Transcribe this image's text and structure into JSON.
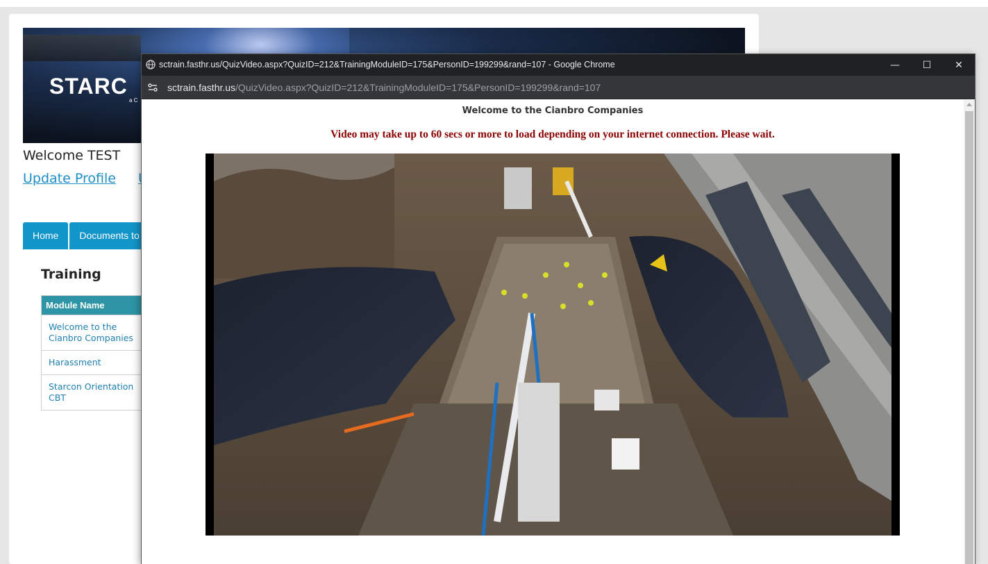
{
  "page": {
    "banner": {
      "logo_text": "STARC",
      "logo_sub": "a C"
    },
    "welcome": "Welcome TEST",
    "links": [
      "Update Profile",
      "U"
    ],
    "tabs": [
      "Home",
      "Documents to C"
    ],
    "training_title": "Training",
    "module_table": {
      "header": "Module Name",
      "rows": [
        "Welcome to the Cianbro Companies",
        "Harassment",
        "Starcon Orientation CBT"
      ]
    }
  },
  "popup": {
    "window_title": "sctrain.fasthr.us/QuizVideo.aspx?QuizID=212&TrainingModuleID=175&PersonID=199299&rand=107 - Google Chrome",
    "address_host": "sctrain.fasthr.us",
    "address_path": "/QuizVideo.aspx?QuizID=212&TrainingModuleID=175&PersonID=199299&rand=107",
    "controls": {
      "minimize": "—",
      "maximize": "☐",
      "close": "✕"
    },
    "heading": "Welcome to the Cianbro Companies",
    "notice": "Video may take up to 60 secs or more to load depending on your internet connection. Please wait.",
    "icons": [
      "globe-icon",
      "site-info-icon"
    ]
  },
  "colors": {
    "link": "#1e8fc6",
    "tab": "#1295c9",
    "table_header": "#2d95a6",
    "notice": "#8b0000",
    "chrome_dark": "#202124"
  }
}
